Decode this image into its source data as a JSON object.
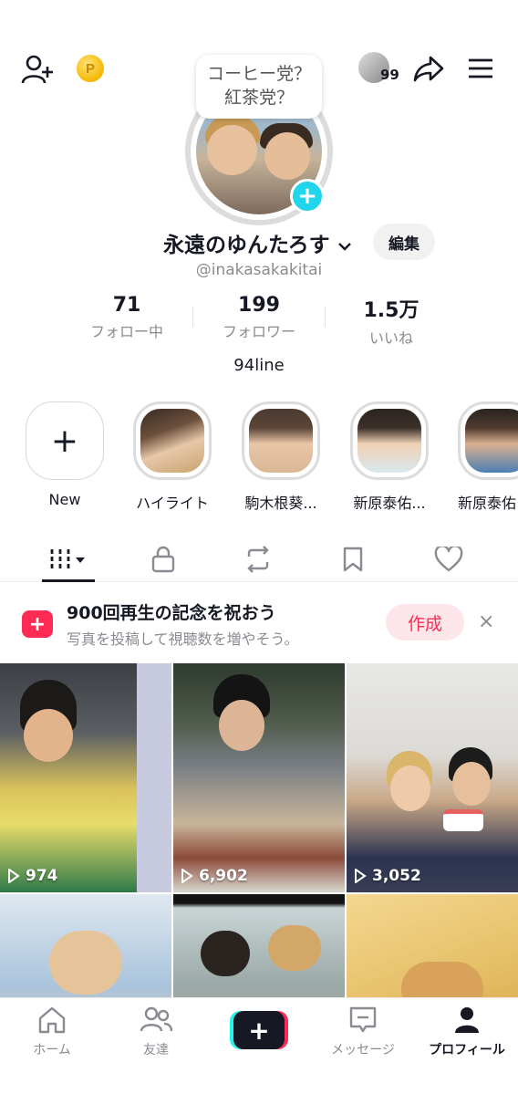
{
  "header": {
    "bubble_line1": "コーヒー党？",
    "bubble_line2": "紅茶党？",
    "coin_glyph": "P",
    "friends_count": "99"
  },
  "profile": {
    "name": "永遠のゆんたろす",
    "edit_label": "編集",
    "handle": "@inakasakakitai",
    "bio": "94line"
  },
  "stats": [
    {
      "value": "71",
      "label": "フォロー中"
    },
    {
      "value": "199",
      "label": "フォロワー"
    },
    {
      "value": "1.5万",
      "label": "いいね"
    }
  ],
  "highlights": [
    {
      "label": "New",
      "icon": "plus-icon"
    },
    {
      "label": "ハイライト"
    },
    {
      "label": "駒木根葵..."
    },
    {
      "label": "新原泰佑..."
    },
    {
      "label": "新原泰佑"
    }
  ],
  "tabs": [
    {
      "icon": "videos-grid-icon",
      "active": true
    },
    {
      "icon": "lock-icon"
    },
    {
      "icon": "repost-icon"
    },
    {
      "icon": "bookmark-icon"
    },
    {
      "icon": "heart-icon"
    }
  ],
  "banner": {
    "title": "900回再生の記念を祝おう",
    "subtitle": "写真を投稿して視聴数を増やそう。",
    "button": "作成",
    "close": "×"
  },
  "videos": [
    {
      "views": "974"
    },
    {
      "views": "6,902"
    },
    {
      "views": "3,052"
    },
    {
      "views": ""
    },
    {
      "views": ""
    },
    {
      "views": ""
    }
  ],
  "bottom_nav": [
    {
      "label": "ホーム",
      "icon": "home-icon"
    },
    {
      "label": "友達",
      "icon": "friends-icon"
    },
    {
      "label": "",
      "icon": "create-plus-icon"
    },
    {
      "label": "メッセージ",
      "icon": "message-icon"
    },
    {
      "label": "プロフィール",
      "icon": "profile-icon",
      "active": true
    }
  ],
  "colors": {
    "accent": "#fe2c55",
    "cyan": "#20d5ec",
    "text": "#161823",
    "muted": "#8a8b91"
  }
}
